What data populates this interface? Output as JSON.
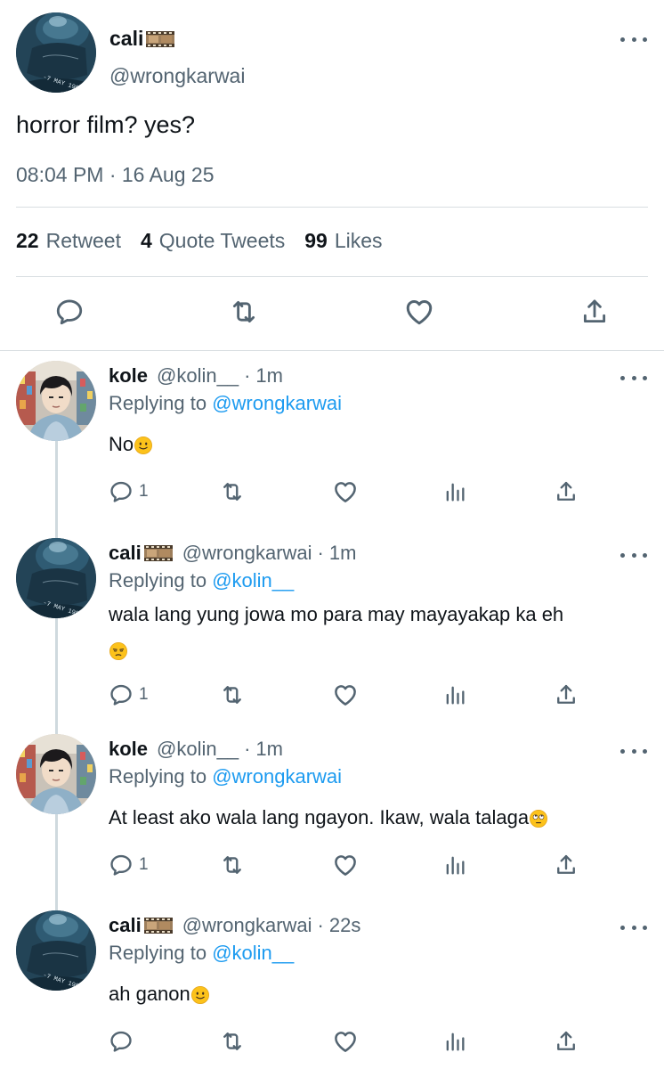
{
  "main_tweet": {
    "author_name": "cali",
    "author_handle": "@wrongkarwai",
    "text": "horror film? yes?",
    "timestamp": "08:04 PM · 16 Aug 25",
    "stats": {
      "retweets_count": "22",
      "retweets_label": "Retweet",
      "quotes_count": "4",
      "quotes_label": "Quote Tweets",
      "likes_count": "99",
      "likes_label": "Likes"
    },
    "actions": [
      "reply-icon",
      "retweet-icon",
      "like-icon",
      "share-icon"
    ]
  },
  "replies": [
    {
      "name": "kole",
      "handle": "@kolin__",
      "separator": "·",
      "time": "1m",
      "replying_prefix": "Replying to",
      "replying_to": "@wrongkarwai",
      "text": "No",
      "emoji": "slightly-smiling-face",
      "reply_count": "1"
    },
    {
      "name": "cali",
      "handle": "@wrongkarwai",
      "separator": "·",
      "time": "1m",
      "replying_prefix": "Replying to",
      "replying_to": "@kolin__",
      "text": "wala lang yung jowa mo para may mayayakap ka eh",
      "emoji": "unamused-face",
      "reply_count": "1"
    },
    {
      "name": "kole",
      "handle": "@kolin__",
      "separator": "·",
      "time": "1m",
      "replying_prefix": "Replying to",
      "replying_to": "@wrongkarwai",
      "text": "At least ako wala lang ngayon. Ikaw, wala talaga",
      "emoji": "face-with-rolling-eyes",
      "reply_count": "1"
    },
    {
      "name": "cali",
      "handle": "@wrongkarwai",
      "separator": "·",
      "time": "22s",
      "replying_prefix": "Replying to",
      "replying_to": "@kolin__",
      "text": "ah ganon",
      "emoji": "slightly-smiling-face",
      "reply_count": ""
    }
  ],
  "colors": {
    "text_primary": "#0f1419",
    "text_secondary": "#536471",
    "link": "#1d9bf0",
    "divider": "#d9dee2",
    "thread_line": "#cfd9de"
  },
  "avatar_stamp": "-7 MAY 1994"
}
